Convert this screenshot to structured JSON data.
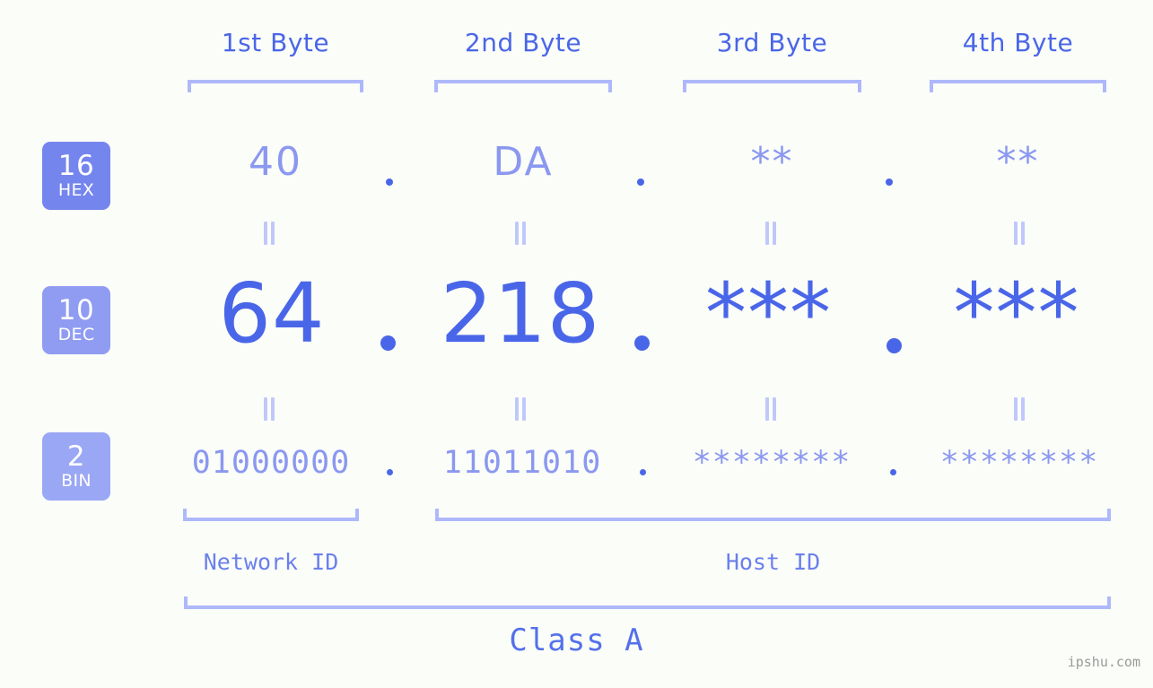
{
  "meta": {
    "background_color": "#fbfdf9",
    "accent_color": "#4a66e8",
    "light_accent_color": "#8b98f0",
    "bracket_color": "#aeb8fb",
    "watermark": "ipshu.com"
  },
  "byte_headers": [
    {
      "label": "1st Byte"
    },
    {
      "label": "2nd Byte"
    },
    {
      "label": "3rd Byte"
    },
    {
      "label": "4th Byte"
    }
  ],
  "bases": [
    {
      "number": "16",
      "abbr": "HEX",
      "color": "#7585ee"
    },
    {
      "number": "10",
      "abbr": "DEC",
      "color": "#8f9cf2"
    },
    {
      "number": "2",
      "abbr": "BIN",
      "color": "#9aa7f5"
    }
  ],
  "rows": {
    "hex": {
      "values": [
        "40",
        "DA",
        "**",
        "**"
      ],
      "separator": "."
    },
    "dec": {
      "values": [
        "64",
        "218",
        "***",
        "***"
      ],
      "separator": "."
    },
    "bin": {
      "values": [
        "01000000",
        "11011010",
        "********",
        "********"
      ],
      "separator": "."
    }
  },
  "equals_marks": {
    "symbol": "=",
    "count_per_row": 4
  },
  "id_labels": [
    {
      "label": "Network ID"
    },
    {
      "label": "Host ID"
    }
  ],
  "class_label": "Class A",
  "separators": {
    "dot": "."
  }
}
